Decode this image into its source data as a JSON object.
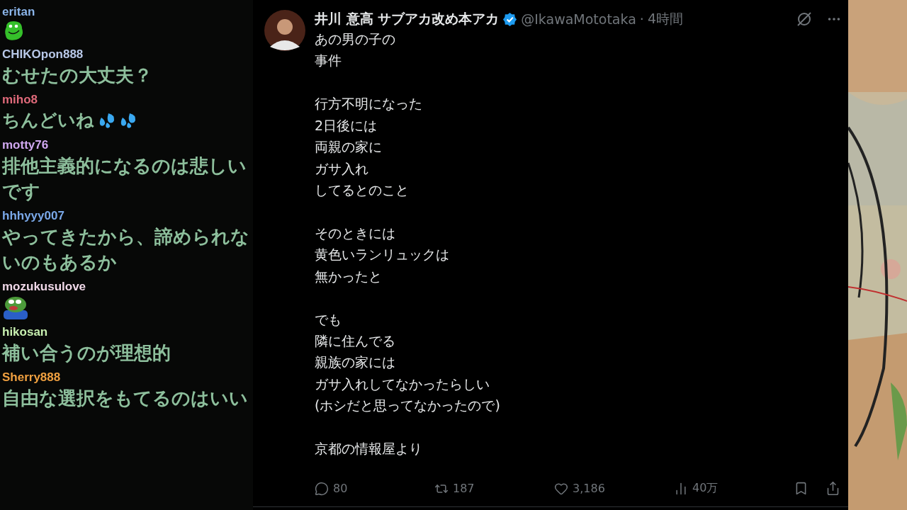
{
  "chat": [
    {
      "user": "eritan",
      "color": "#8ab4e8",
      "kind": "frog"
    },
    {
      "user": "CHIKOpon888",
      "color": "#b8c8e8",
      "kind": "text",
      "text": "むせたの大丈夫？"
    },
    {
      "user": "miho8",
      "color": "#e06a7a",
      "kind": "text",
      "text": "ちんどいね",
      "emotes": [
        {
          "kind": "sweat"
        },
        {
          "kind": "sweat"
        }
      ]
    },
    {
      "user": "motty76",
      "color": "#d0a8f0",
      "kind": "text",
      "text": "排他主義的になるのは悲しいです"
    },
    {
      "user": "hhhyyy007",
      "color": "#7aa8e8",
      "kind": "text",
      "text": "やってきたから、諦められないのもあるか"
    },
    {
      "user": "mozukusulove",
      "color": "#f0d8e8",
      "kind": "pepe"
    },
    {
      "user": "hikosan",
      "color": "#c8f0b0",
      "kind": "text",
      "text": "補い合うのが理想的"
    },
    {
      "user": "Sherry888",
      "color": "#f0a040",
      "kind": "text",
      "text": "自由な選択をもてるのはいい"
    }
  ],
  "tweet": {
    "name": "井川 意高 サブアカ改め本アカ",
    "verified": true,
    "handle": "@IkawaMototaka",
    "separator": "·",
    "time": "4時間",
    "paragraphs": [
      [
        "あの男の子の",
        "事件"
      ],
      [
        "行方不明になった",
        "2日後には",
        "両親の家に",
        "ガサ入れ",
        "してるとのこと"
      ],
      [
        "そのときには",
        "黄色いランリュックは",
        "無かったと"
      ],
      [
        "でも",
        "隣に住んでる",
        "親族の家には",
        "ガサ入れしてなかったらしい",
        "(ホシだと思ってなかったので)"
      ],
      [
        "京都の情報屋より"
      ]
    ],
    "actions": [
      {
        "kind": "reply",
        "count": "80"
      },
      {
        "kind": "repost",
        "count": "187"
      },
      {
        "kind": "like",
        "count": "3,186"
      },
      {
        "kind": "views",
        "count": "40万"
      }
    ]
  }
}
